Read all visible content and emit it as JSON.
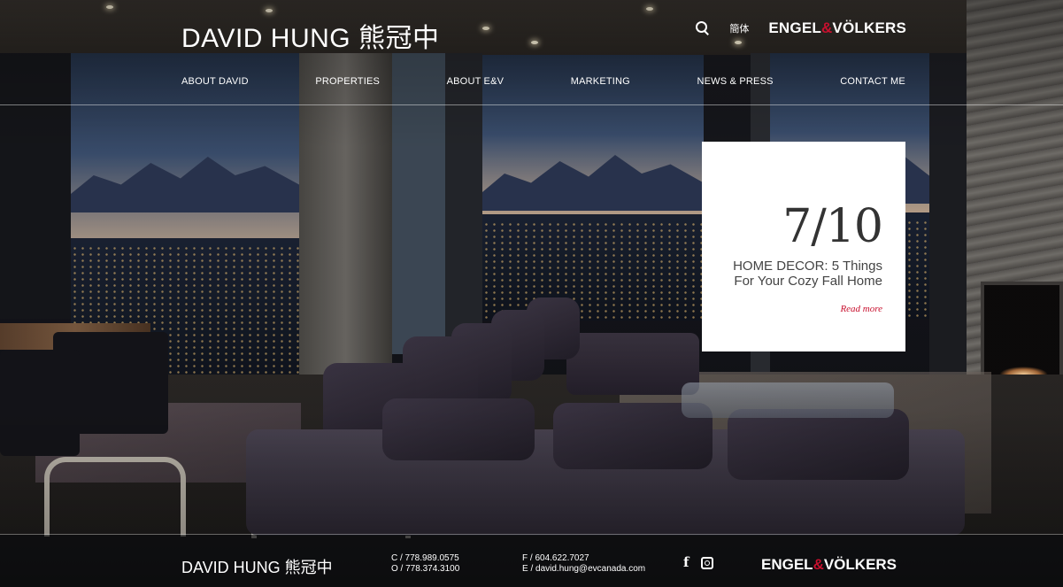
{
  "header": {
    "brand": "DAVID HUNG 熊冠中",
    "language_toggle": "簡体",
    "logo": {
      "left": "ENGEL",
      "amp": "&",
      "right": "VÖLKERS"
    }
  },
  "nav": {
    "items": [
      {
        "label": "ABOUT DAVID"
      },
      {
        "label": "PROPERTIES"
      },
      {
        "label": "ABOUT E&V"
      },
      {
        "label": "MARKETING"
      },
      {
        "label": "NEWS & PRESS"
      },
      {
        "label": "CONTACT ME"
      }
    ]
  },
  "feature": {
    "date": "7/10",
    "title": "HOME DECOR: 5 Things For Your Cozy Fall Home",
    "read_more": "Read more"
  },
  "footer": {
    "brand": "DAVID HUNG 熊冠中",
    "phone_cell": "C / 778.989.0575",
    "phone_office": "O / 778.374.3100",
    "fax": "F / 604.622.7027",
    "email": "E / david.hung@evcanada.com",
    "social": [
      "facebook",
      "instagram"
    ],
    "logo": {
      "left": "ENGEL",
      "amp": "&",
      "right": "VÖLKERS"
    }
  },
  "colors": {
    "accent_red": "#c8102e",
    "card_bg": "#ffffff",
    "text_white": "#ffffff"
  },
  "icons": [
    "search-icon",
    "facebook-icon",
    "instagram-icon"
  ]
}
